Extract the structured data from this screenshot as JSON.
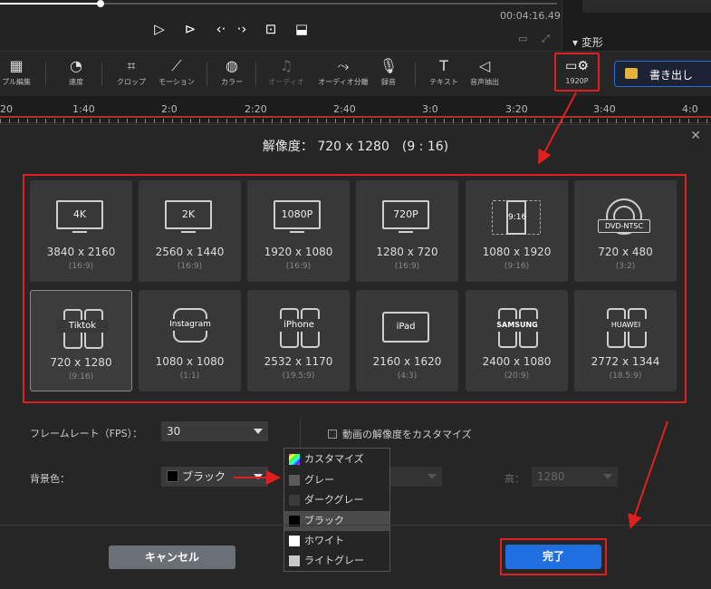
{
  "player": {
    "timecode": "00:04:16.49",
    "progress": 0.18
  },
  "panel": {
    "transform_label": "▾ 変形"
  },
  "toolbar": {
    "tools": [
      {
        "label": "プル編集",
        "icon": "▦"
      },
      {
        "label": "速度",
        "icon": "◔"
      },
      {
        "label": "クロップ",
        "icon": "⌗"
      },
      {
        "label": "モーション",
        "icon": "⟋"
      },
      {
        "label": "カラー",
        "icon": "◍"
      },
      {
        "label": "オーディオ",
        "icon": "♫"
      },
      {
        "label": "オーディオ分離",
        "icon": "⤳"
      },
      {
        "label": "録音",
        "icon": "🎙"
      },
      {
        "label": "テキスト",
        "icon": "T"
      },
      {
        "label": "音声抽出",
        "icon": "◁"
      }
    ],
    "resolution_label": "1920P",
    "export_label": "書き出し"
  },
  "ruler": {
    "labels": [
      "20",
      "1:40",
      "2:0",
      "2:20",
      "2:40",
      "3:0",
      "3:20",
      "3:40",
      "4:0"
    ]
  },
  "dialog": {
    "title": "解像度： 720 x 1280　(9 : 16)",
    "presets": [
      {
        "name": "4K",
        "size": "3840 x 2160",
        "ratio": "(16:9)",
        "kind": "monitor"
      },
      {
        "name": "2K",
        "size": "2560 x 1440",
        "ratio": "(16:9)",
        "kind": "monitor"
      },
      {
        "name": "1080P",
        "size": "1920 x 1080",
        "ratio": "(16:9)",
        "kind": "monitor"
      },
      {
        "name": "720P",
        "size": "1280 x 720",
        "ratio": "(16:9)",
        "kind": "monitor"
      },
      {
        "name": "9:16",
        "size": "1080 x 1920",
        "ratio": "(9:16)",
        "kind": "vertical"
      },
      {
        "name": "DVD-NTSC",
        "size": "720 x 480",
        "ratio": "(3:2)",
        "kind": "dvd"
      },
      {
        "name": "Tiktok",
        "size": "720 x 1280",
        "ratio": "(9:16)",
        "kind": "phones"
      },
      {
        "name": "Instagram",
        "size": "1080 x 1080",
        "ratio": "(1:1)",
        "kind": "insta"
      },
      {
        "name": "iPhone",
        "size": "2532 x 1170",
        "ratio": "(19.5:9)",
        "kind": "phones"
      },
      {
        "name": "iPad",
        "size": "2160 x 1620",
        "ratio": "(4:3)",
        "kind": "tablet"
      },
      {
        "name": "SAMSUNG",
        "size": "2400 x 1080",
        "ratio": "(20:9)",
        "kind": "phones"
      },
      {
        "name": "HUAWEI",
        "size": "2772 x 1344",
        "ratio": "(18.5:9)",
        "kind": "phones"
      }
    ],
    "fps_label": "フレームレート（FPS）：",
    "fps_value": "30",
    "bg_label": "背景色：",
    "bg_value": "ブラック",
    "custom_checkbox_label": "動画の解像度をカスタマイズ",
    "height_label": "高：",
    "height_value": "1280",
    "color_options": [
      {
        "label": "カスタマイズ",
        "color": "rainbow"
      },
      {
        "label": "グレー",
        "color": "#5a5a5a"
      },
      {
        "label": "ダークグレー",
        "color": "#3a3a3a"
      },
      {
        "label": "ブラック",
        "color": "#000000"
      },
      {
        "label": "ホワイト",
        "color": "#ffffff"
      },
      {
        "label": "ライトグレー",
        "color": "#c8c8c8"
      }
    ],
    "cancel_label": "キャンセル",
    "done_label": "完了"
  },
  "colors": {
    "accent": "#1f6fe0",
    "highlight": "#e02020"
  }
}
